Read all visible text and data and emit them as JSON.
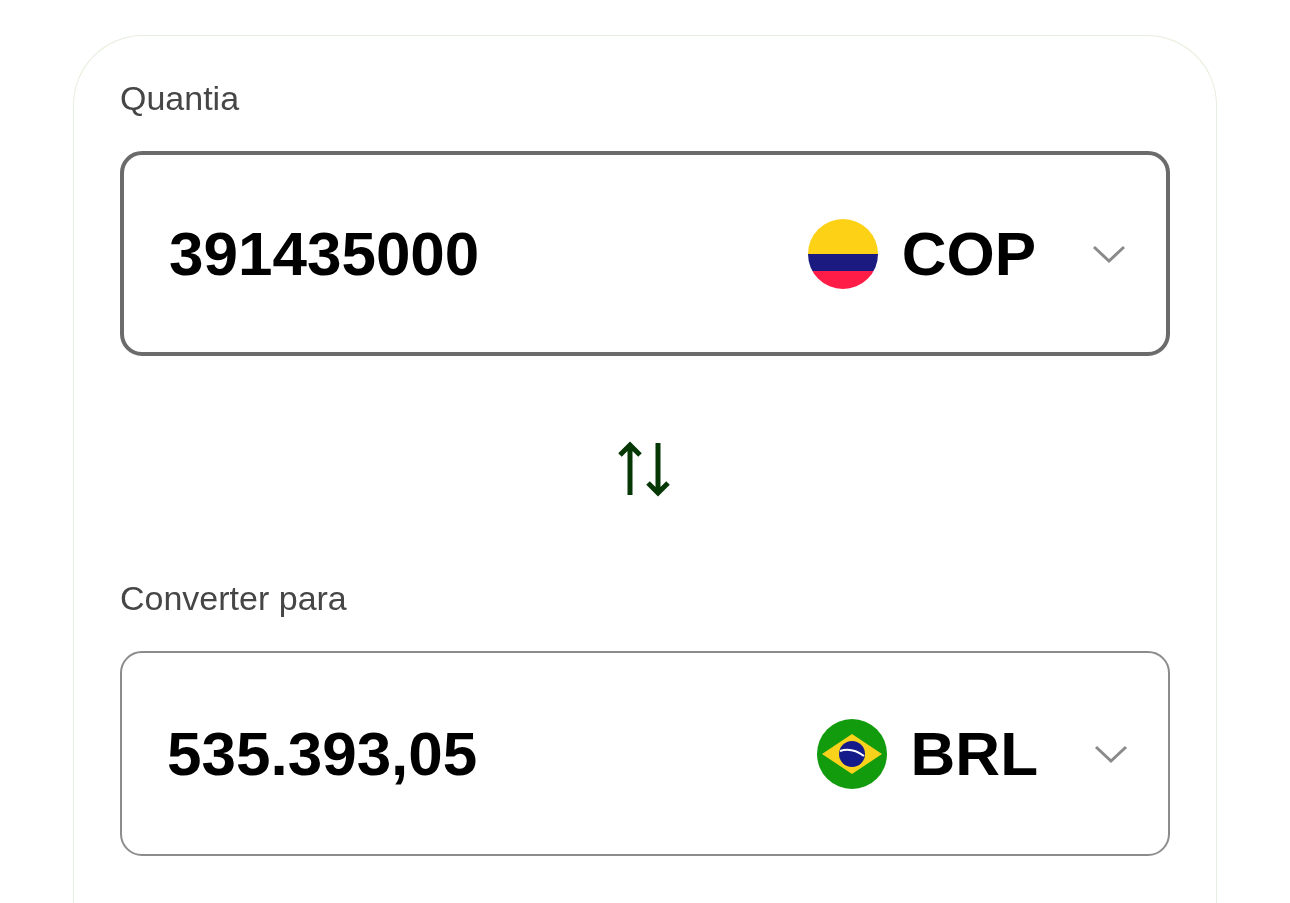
{
  "fields": [
    {
      "label": "Quantia",
      "value": "391435000",
      "currency": "COP",
      "focused": true
    },
    {
      "label": "Converter para",
      "value": "535.393,05",
      "currency": "BRL",
      "focused": false
    }
  ]
}
